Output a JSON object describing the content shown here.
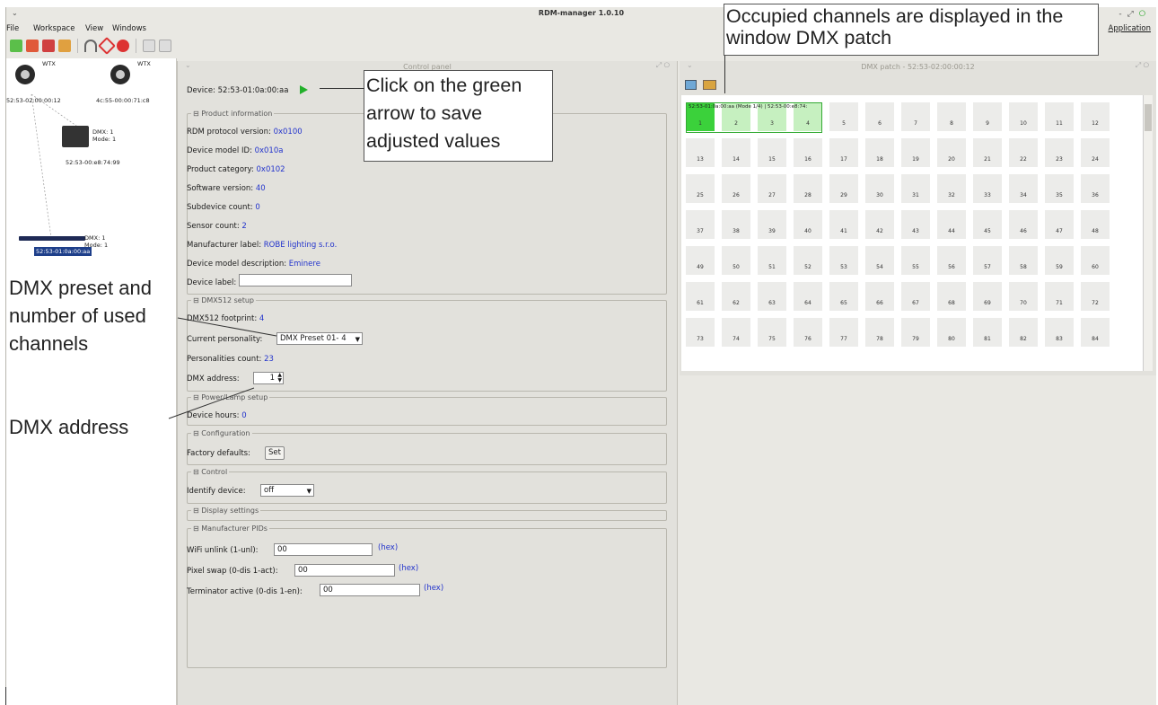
{
  "window": {
    "title": "RDM-manager 1.0.10",
    "menu": [
      "File",
      "Workspace",
      "View",
      "Windows"
    ],
    "app_menu": "Application",
    "win_menu_glyph": "⌄"
  },
  "toolbar": {
    "icons": [
      "add-device-icon",
      "remove-device-icon",
      "disconnect-icon",
      "refresh-icon",
      "wifi-icon",
      "tag-icon",
      "search-icon",
      "window-icon",
      "panel-icon"
    ]
  },
  "devices": {
    "wtx1": {
      "badge": "WTX",
      "id": "52:53-02:00:00:12"
    },
    "wtx2": {
      "badge": "WTX",
      "id": "4c:55-00:00:71:c8"
    },
    "dev1": {
      "dmx": "DMX: 1",
      "mode": "Mode: 1",
      "id": "52:53-00:e8:74:99"
    },
    "dev2": {
      "dmx": "DMX: 1",
      "mode": "Mode: 1",
      "id": "52:53-01:0a:00:aa"
    }
  },
  "control": {
    "title": "Control panel",
    "device": "Device: 52:53-01:0a:00:aa",
    "product": {
      "legend": "⊟ Product information",
      "rdm_label": "RDM protocol version:",
      "rdm": "0x0100",
      "model_label": "Device model ID:",
      "model": "0x010a",
      "cat_label": "Product category:",
      "cat": "0x0102",
      "sw_label": "Software version:",
      "sw": "40",
      "sub_label": "Subdevice count:",
      "sub": "0",
      "sensor_label": "Sensor count:",
      "sensor": "2",
      "mfr_label": "Manufacturer label:",
      "mfr": "ROBE lighting s.r.o.",
      "desc_label": "Device model description:",
      "desc": "Eminere",
      "devlabel_label": "Device label:"
    },
    "dmx": {
      "legend": "⊟ DMX512 setup",
      "footprint_label": "DMX512 footprint:",
      "footprint": "4",
      "personality_label": "Current personality:",
      "personality": "DMX Preset 01- 4",
      "pcount_label": "Personalities count:",
      "pcount": "23",
      "address_label": "DMX address:",
      "address": "1"
    },
    "power": {
      "legend": "⊟ Power/Lamp setup",
      "hours_label": "Device hours:",
      "hours": "0"
    },
    "config": {
      "legend": "⊟ Configuration",
      "factory_label": "Factory defaults:",
      "set": "Set"
    },
    "control": {
      "legend": "⊟ Control",
      "identify_label": "Identify device:",
      "identify": "off"
    },
    "display": {
      "legend": "⊟ Display settings"
    },
    "pids": {
      "legend": "⊟ Manufacturer PIDs",
      "wifi_label": "WiFi unlink (1-unl):",
      "wifi": "00",
      "pixel_label": "Pixel swap (0-dis 1-act):",
      "pixel": "00",
      "term_label": "Terminator active (0-dis 1-en):",
      "term": "00",
      "hex": "(hex)"
    }
  },
  "patch": {
    "title": "DMX patch - 52:53-02:00:00:12",
    "device_label": "52:53-01:0a:00:aa (Mode 1/4) | 52:53-00:e8:74:",
    "occupied": [
      1,
      2,
      3,
      4
    ],
    "channels": [
      1,
      2,
      3,
      4,
      5,
      6,
      7,
      8,
      9,
      10,
      11,
      12,
      13,
      14,
      15,
      16,
      17,
      18,
      19,
      20,
      21,
      22,
      23,
      24,
      25,
      26,
      27,
      28,
      29,
      30,
      31,
      32,
      33,
      34,
      35,
      36,
      37,
      38,
      39,
      40,
      41,
      42,
      43,
      44,
      45,
      46,
      47,
      48,
      49,
      50,
      51,
      52,
      53,
      54,
      55,
      56,
      57,
      58,
      59,
      60,
      61,
      62,
      63,
      64,
      65,
      66,
      67,
      68,
      69,
      70,
      71,
      72,
      73,
      74,
      75,
      76,
      77,
      78,
      79,
      80,
      81,
      82,
      83,
      84
    ]
  },
  "annotations": {
    "occupied": "Occupied channels are displayed in the window DMX patch",
    "arrow": "Click on the green arrow to save adjusted values",
    "preset": "DMX preset and number of used channels",
    "address": "DMX address"
  },
  "colors": {
    "value": "#2233cc",
    "occupied": "#c6f0c0",
    "first": "#3bd13b",
    "arrow": "#22b02a"
  }
}
